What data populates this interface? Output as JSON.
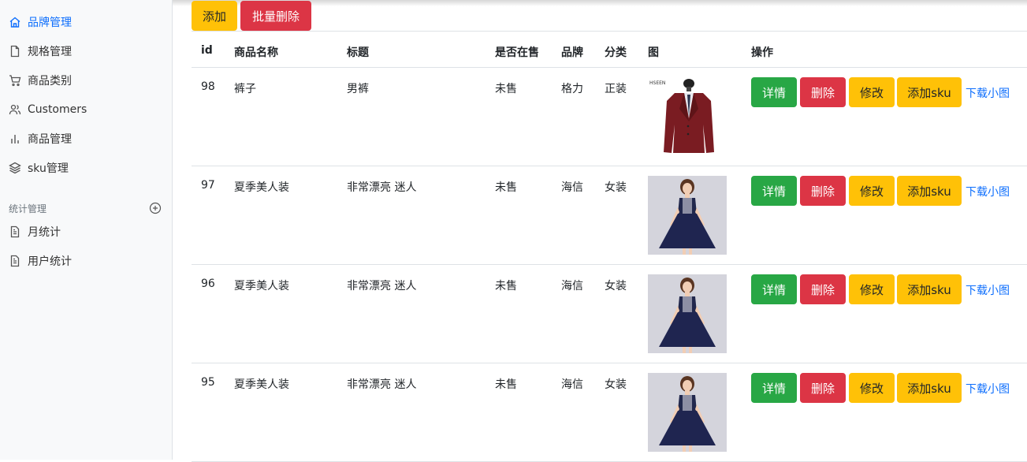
{
  "sidebar": {
    "items": [
      {
        "label": "品牌管理",
        "icon": "home-icon",
        "active": true
      },
      {
        "label": "规格管理",
        "icon": "file-icon"
      },
      {
        "label": "商品类别",
        "icon": "cart-icon"
      },
      {
        "label": "Customers",
        "icon": "users-icon"
      },
      {
        "label": "商品管理",
        "icon": "bar-chart-icon"
      },
      {
        "label": "sku管理",
        "icon": "layers-icon"
      }
    ],
    "section_title": "统计管理",
    "section_items": [
      {
        "label": "月统计",
        "icon": "file-text-icon"
      },
      {
        "label": "用户统计",
        "icon": "file-text-icon"
      }
    ]
  },
  "toolbar": {
    "add_label": "添加",
    "batch_delete_label": "批量删除"
  },
  "table": {
    "columns": [
      "id",
      "商品名称",
      "标题",
      "是否在售",
      "品牌",
      "分类",
      "图",
      "操作"
    ],
    "rows": [
      {
        "id": "98",
        "name": "裤子",
        "title": "男裤",
        "on_sale": "未售",
        "brand": "格力",
        "category": "正装",
        "image": "suit-jacket-photo",
        "image_text": "HSEEN"
      },
      {
        "id": "97",
        "name": "夏季美人装",
        "title": "非常漂亮 迷人",
        "on_sale": "未售",
        "brand": "海信",
        "category": "女装",
        "image": "navy-dress-photo"
      },
      {
        "id": "96",
        "name": "夏季美人装",
        "title": "非常漂亮 迷人",
        "on_sale": "未售",
        "brand": "海信",
        "category": "女装",
        "image": "navy-dress-photo"
      },
      {
        "id": "95",
        "name": "夏季美人装",
        "title": "非常漂亮 迷人",
        "on_sale": "未售",
        "brand": "海信",
        "category": "女装",
        "image": "navy-dress-photo"
      }
    ],
    "actions": {
      "detail": "详情",
      "delete": "删除",
      "edit": "修改",
      "add_sku": "添加sku",
      "download": "下载小图"
    }
  },
  "colors": {
    "primary": "#0d6efd",
    "success": "#28a745",
    "danger": "#dc3545",
    "warning": "#ffc107"
  }
}
